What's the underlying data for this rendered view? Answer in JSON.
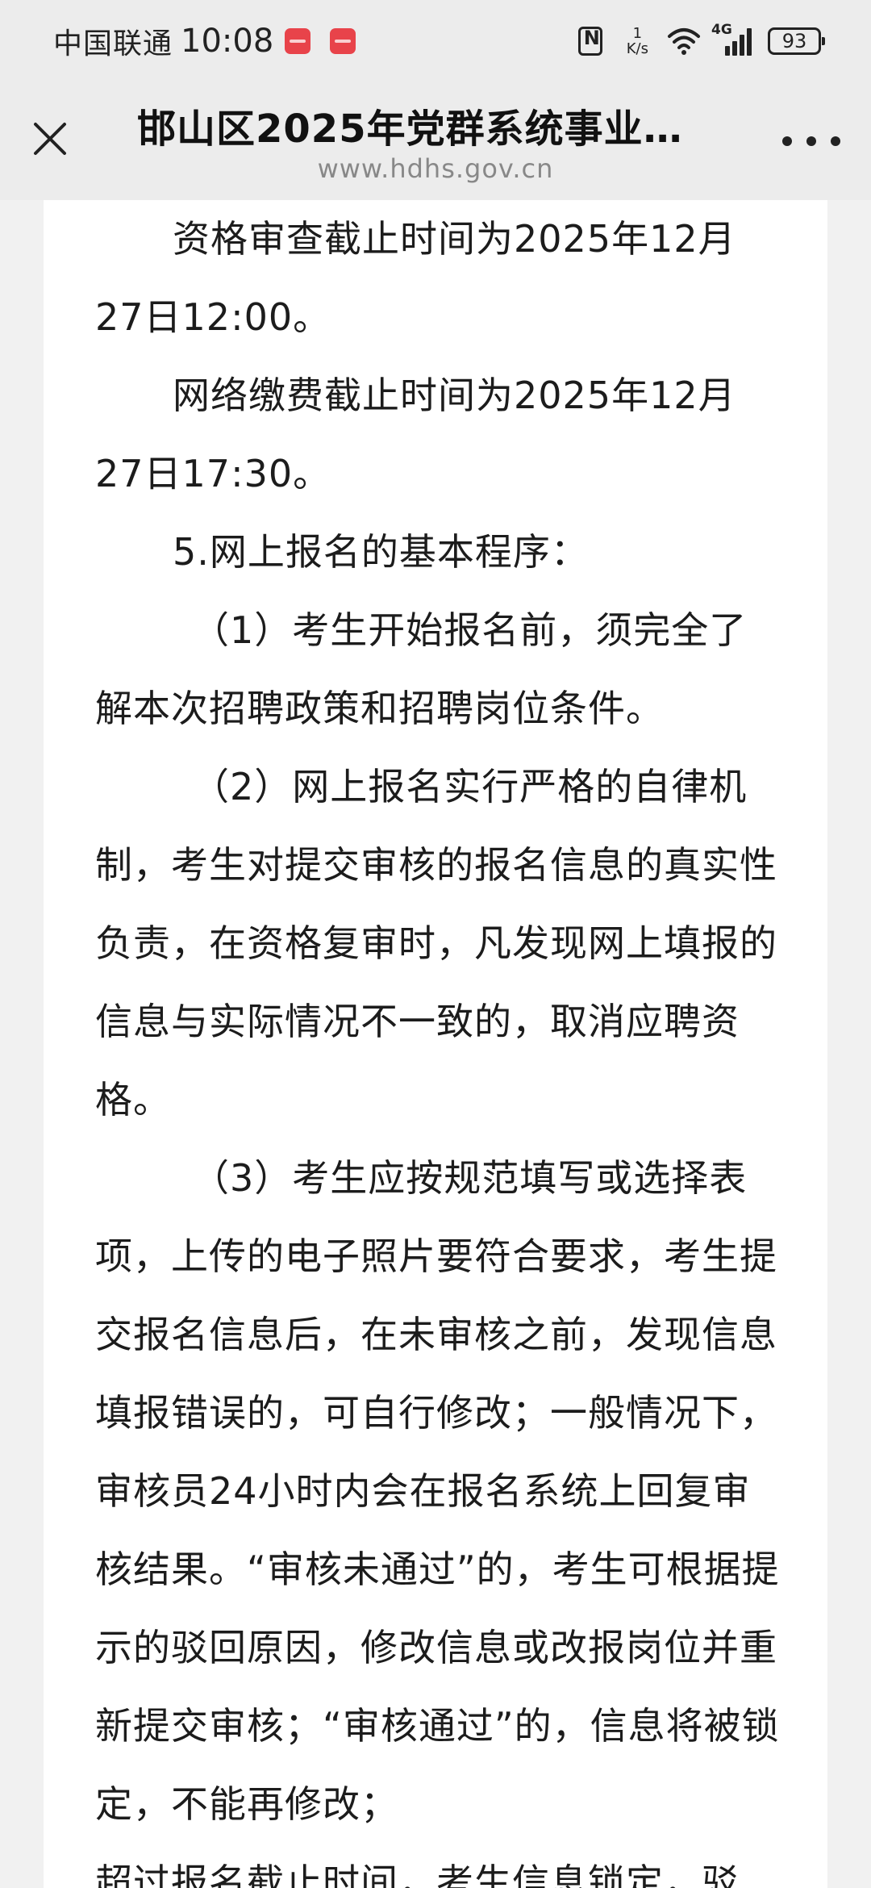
{
  "status_bar": {
    "carrier": "中国联通",
    "time": "10:08",
    "net_speed_value": "1",
    "net_speed_unit": "K/s",
    "network_type": "4G",
    "battery": "93"
  },
  "header": {
    "title": "邯山区2025年党群系统事业…",
    "url": "www.hdhs.gov.cn",
    "close_icon": "close-icon",
    "more_icon": "more-dots-icon"
  },
  "article": {
    "paragraphs": [
      "资格审查截止时间为2025年12月27日12:00。",
      "网络缴费截止时间为2025年12月27日17:30。",
      "5.网上报名的基本程序：",
      "（1）考生开始报名前，须完全了解本次招聘政策和招聘岗位条件。",
      "（2）网上报名实行严格的自律机制，考生对提交审核的报名信息的真实性负责，在资格复审时，凡发现网上填报的信息与实际情况不一致的，取消应聘资格。",
      "（3）考生应按规范填写或选择表项，上传的电子照片要符合要求，考生提交报名信息后，在未审核之前，发现信息填报错误的，可自行修改；一般情况下，审核员24小时内会在报名系统上回复审核结果。“审核未通过”的，考生可根据提示的驳回原因，修改信息或改报岗位并重新提交审核；“审核通过”的，信息将被锁定，不能再修改；",
      "超过报名截止时间，考生信息锁定，驳"
    ]
  },
  "colors": {
    "chrome_bg": "#ececec",
    "page_bg": "#f1f1f1",
    "card_bg": "#ffffff",
    "text": "#1c1c1c",
    "url_text": "#888888"
  }
}
